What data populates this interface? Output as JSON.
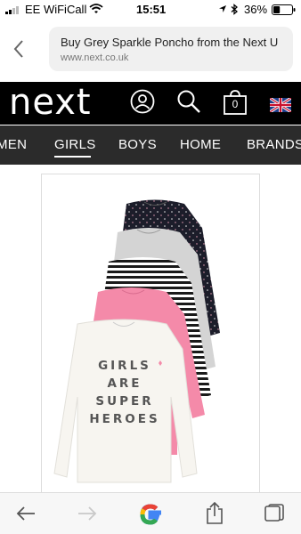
{
  "status_bar": {
    "carrier": "EE WiFiCall",
    "time": "15:51",
    "battery_percent": "36%",
    "battery_level": 0.36
  },
  "browser": {
    "page_title": "Buy Grey Sparkle Poncho from the Next U",
    "domain": "www.next.co.uk"
  },
  "header": {
    "logo_text": "next",
    "bag_count": "0"
  },
  "category_nav": {
    "items": [
      "MEN",
      "GIRLS",
      "BOYS",
      "HOME",
      "BRANDS"
    ],
    "active": "GIRLS"
  },
  "product": {
    "tshirt_print": [
      "GIRLS",
      "ARE",
      "SUPER",
      "HEROES"
    ],
    "colors": {
      "navy": "#1c1d2a",
      "grey": "#d4d4d4",
      "stripe_dark": "#1a1a1a",
      "pink": "#f48aa9",
      "white": "#f7f5f0",
      "print": "#555555"
    }
  },
  "icons": {
    "status": [
      "signal-icon",
      "wifi-icon",
      "location-icon",
      "bluetooth-icon",
      "battery-icon"
    ],
    "header": [
      "account-icon",
      "search-icon",
      "bag-icon",
      "uk-flag-icon"
    ],
    "toolbar": [
      "back-arrow-icon",
      "forward-arrow-icon",
      "google-icon",
      "share-icon",
      "tabs-icon"
    ]
  }
}
